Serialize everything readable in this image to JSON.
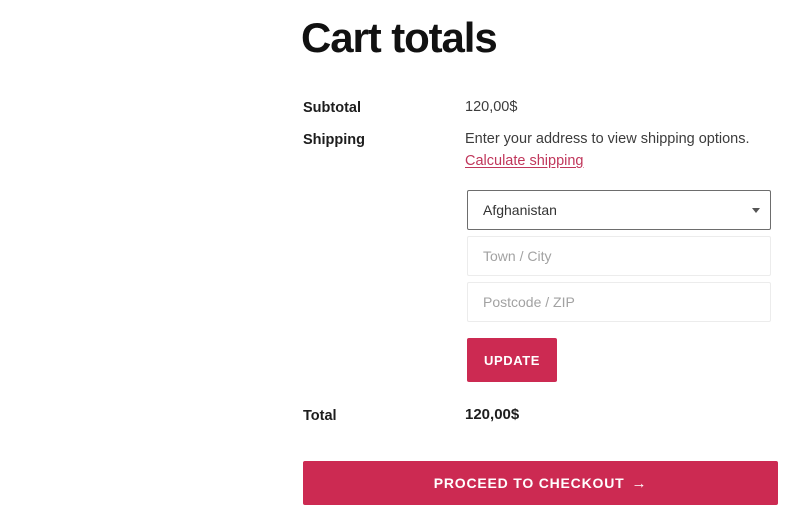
{
  "page": {
    "title": "Cart totals"
  },
  "totals": {
    "rows": [
      {
        "label": "Subtotal",
        "value": "120,00$"
      },
      {
        "label": "Shipping",
        "value": "Enter your address to view shipping options."
      },
      {
        "label": "Total",
        "value": "120,00$"
      }
    ],
    "shipping_link": "Calculate shipping"
  },
  "shipping_form": {
    "country": {
      "selected": "Afghanistan",
      "icon": "chevron-down-icon"
    },
    "city": {
      "placeholder": "Town / City",
      "value": ""
    },
    "postcode": {
      "placeholder": "Postcode / ZIP",
      "value": ""
    },
    "update_label": "UPDATE"
  },
  "checkout": {
    "label": "PROCEED TO CHECKOUT",
    "arrow": "→",
    "icon": "arrow-right-icon"
  },
  "colors": {
    "accent": "#cc2a52",
    "link": "#c0365b",
    "heading": "#111111",
    "text": "#3c3c3c",
    "placeholder": "#a2a2a2",
    "select_border": "#6d6d6d",
    "input_border": "#ececec",
    "background": "#ffffff"
  }
}
